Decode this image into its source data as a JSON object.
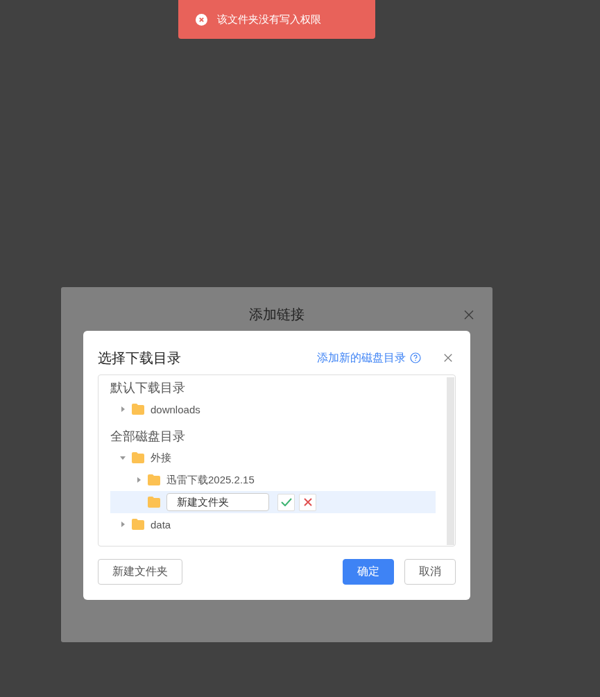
{
  "toast": {
    "message": "该文件夹没有写入权限"
  },
  "parent_dialog": {
    "title": "添加链接"
  },
  "dialog": {
    "title": "选择下载目录",
    "add_link": "添加新的磁盘目录",
    "sections": [
      {
        "heading": "默认下载目录",
        "items": [
          {
            "kind": "folder",
            "name": "downloads",
            "expanded": false,
            "selected": false
          }
        ]
      },
      {
        "heading": "全部磁盘目录",
        "items": [
          {
            "kind": "folder",
            "name": "外接",
            "expanded": true,
            "selected": false,
            "children": [
              {
                "kind": "folder",
                "name": "迅雷下载2025.2.15",
                "expanded": false,
                "selected": false
              },
              {
                "kind": "new-folder",
                "value": "新建文件夹",
                "selected": true
              }
            ]
          },
          {
            "kind": "folder",
            "name": "data",
            "expanded": false,
            "selected": false
          }
        ]
      }
    ],
    "buttons": [
      {
        "kind": "secondary",
        "label": "新建文件夹"
      },
      {
        "kind": "primary",
        "label": "确定"
      },
      {
        "kind": "secondary",
        "label": "取消"
      }
    ]
  }
}
